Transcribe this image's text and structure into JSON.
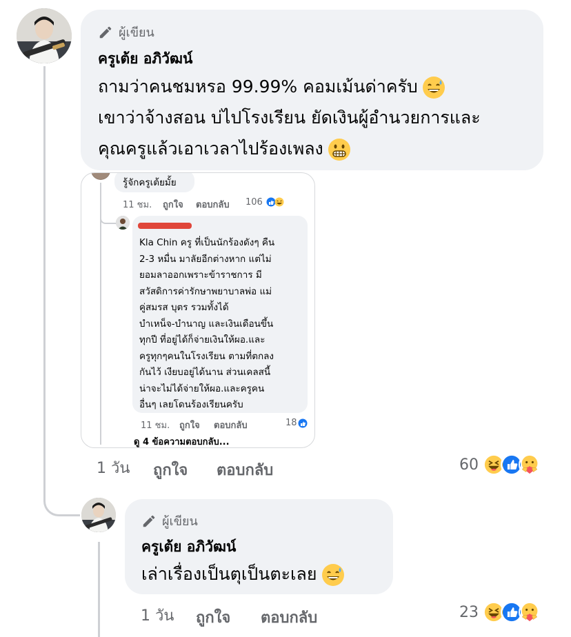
{
  "colors": {
    "bubble_bg": "#f0f2f5",
    "muted_text": "#65676b",
    "thread_line": "#ced0d4",
    "like_blue": "#1877f2"
  },
  "comment1": {
    "author_badge": "ผู้เขียน",
    "author_name": "ครูเต้ย อภิวัฒน์",
    "lines": [
      "ถามว่าคนชมหรอ 99.99% คอมเม้นด่าครับ",
      "เขาว่าจ้างสอน บ่ไปโรงเรียน ยัดเงินผู้อำนวยการและ",
      "คุณครูแล้วเอาเวลาไปร้องเพลง"
    ],
    "line1_emoji": "sweat-smile-emoji",
    "line3_emoji": "grimace-emoji",
    "time": "1 วัน",
    "like": "ถูกใจ",
    "reply": "ตอบกลับ",
    "reaction_count": "60",
    "reaction_icons": [
      "laugh-reaction-icon",
      "like-reaction-icon",
      "care-reaction-icon"
    ]
  },
  "embedded": {
    "top_comment_text": "รู้จักครูเต้ยมั้ย",
    "top_time": "11 ชม.",
    "top_like": "ถูกใจ",
    "top_reply": "ตอบกลับ",
    "top_reaction_count": "106",
    "reply_lines": [
      "Kla Chin ครู ที่เป็นนักร้องดังๆ คืน",
      "2-3 หมื่น มาลัยอีกต่างหาก  แต่ไม่",
      "ยอมลาออกเพราะข้าราชการ มี",
      "สวัสดิการค่ารักษาพยาบาลพ่อ แม่",
      "คู่สมรส บุตร รวมทั้งได้",
      "บำเหน็จ-บำนาญ และเงินเดือนขึ้น",
      "ทุกปี  ที่อยู่ได้ก็จ่ายเงินให้ผอ.และ",
      "ครูทุกๆคนในโรงเรียน ตามที่ตกลง",
      "กันไว้  เงียบอยู่ได้นาน  ส่วนเคลสนี้",
      "น่าจะไม่ได้จ่ายให้ผอ.และครูคน",
      "อื่นๆ เลยโดนร้องเรียนครับ"
    ],
    "reply_time": "11 ชม.",
    "reply_like": "ถูกใจ",
    "reply_reply": "ตอบกลับ",
    "reply_reaction_count": "18",
    "view_more": "ดู 4 ข้อความตอบกลับ..."
  },
  "comment2": {
    "author_badge": "ผู้เขียน",
    "author_name": "ครูเต้ย อภิวัฒน์",
    "text": "เล่าเรื่องเป็นตุเป็นตะเลย",
    "emoji": "sweat-smile-emoji",
    "time": "1 วัน",
    "like": "ถูกใจ",
    "reply": "ตอบกลับ",
    "reaction_count": "23",
    "reaction_icons": [
      "laugh-reaction-icon",
      "like-reaction-icon",
      "care-reaction-icon"
    ]
  }
}
